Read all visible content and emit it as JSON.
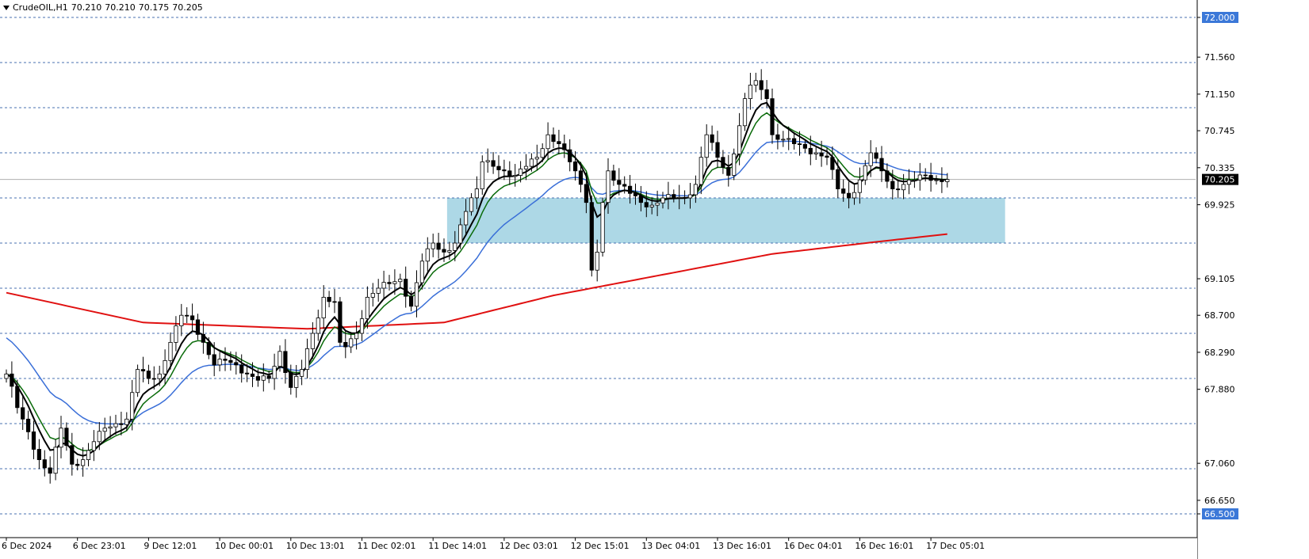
{
  "header": {
    "symbol": "CrudeOIL,H1",
    "open": "70.210",
    "high": "70.210",
    "low": "70.175",
    "close": "70.205"
  },
  "colors": {
    "background": "#ffffff",
    "grid_dashed": "#4a72b0",
    "level_badge": "#3b78d8",
    "current_badge": "#000000",
    "zone_fill": "#add8e6",
    "ma_black": "#000000",
    "ma_green": "#0a6b0a",
    "ma_blue": "#3a6fd8",
    "ma_red": "#e01010",
    "candle_border": "#000000",
    "candle_bull": "#ffffff",
    "candle_bear": "#000000"
  },
  "chart_data": {
    "type": "candlestick",
    "ylim": [
      66.5,
      72.2
    ],
    "y_tick_labels": [
      "72.000",
      "71.560",
      "71.150",
      "70.745",
      "70.335",
      "69.925",
      "69.105",
      "68.700",
      "68.290",
      "67.880",
      "67.060",
      "66.650",
      "66.500"
    ],
    "level_lines": [
      "72.000",
      "71.500",
      "71.000",
      "70.500",
      "70.000",
      "69.500",
      "69.000",
      "68.500",
      "68.000",
      "67.500",
      "67.000",
      "66.500"
    ],
    "current_price": "70.205",
    "x_tick_labels": [
      "6 Dec 2024",
      "6 Dec 23:01",
      "9 Dec 12:01",
      "10 Dec 00:01",
      "10 Dec 13:01",
      "11 Dec 02:01",
      "11 Dec 14:01",
      "12 Dec 03:01",
      "12 Dec 15:01",
      "13 Dec 04:01",
      "13 Dec 16:01",
      "16 Dec 04:01",
      "16 Dec 16:01",
      "17 Dec 05:01"
    ],
    "x_tick_bar_index": [
      0,
      13,
      26,
      39,
      52,
      65,
      78,
      91,
      104,
      117,
      130,
      143,
      156,
      169
    ],
    "zone": {
      "bar_start": 81,
      "bar_end": 183,
      "y_low": 69.5,
      "y_high": 70.0
    },
    "anchors": [
      [
        0,
        68.05
      ],
      [
        3,
        67.55
      ],
      [
        6,
        67.1
      ],
      [
        8,
        66.95
      ],
      [
        10,
        67.45
      ],
      [
        12,
        67.05
      ],
      [
        14,
        67.1
      ],
      [
        16,
        67.3
      ],
      [
        18,
        67.45
      ],
      [
        20,
        67.5
      ],
      [
        22,
        67.55
      ],
      [
        24,
        68.1
      ],
      [
        26,
        68.0
      ],
      [
        28,
        68.05
      ],
      [
        30,
        68.4
      ],
      [
        32,
        68.7
      ],
      [
        34,
        68.65
      ],
      [
        36,
        68.4
      ],
      [
        38,
        68.15
      ],
      [
        40,
        68.2
      ],
      [
        42,
        68.15
      ],
      [
        44,
        68.05
      ],
      [
        46,
        67.98
      ],
      [
        48,
        68.0
      ],
      [
        50,
        68.3
      ],
      [
        52,
        67.9
      ],
      [
        54,
        68.1
      ],
      [
        56,
        68.5
      ],
      [
        58,
        68.9
      ],
      [
        60,
        68.85
      ],
      [
        61,
        68.4
      ],
      [
        62,
        68.35
      ],
      [
        64,
        68.5
      ],
      [
        66,
        68.9
      ],
      [
        68,
        69.0
      ],
      [
        70,
        69.05
      ],
      [
        72,
        69.1
      ],
      [
        74,
        68.8
      ],
      [
        76,
        69.3
      ],
      [
        78,
        69.5
      ],
      [
        80,
        69.4
      ],
      [
        82,
        69.5
      ],
      [
        84,
        69.85
      ],
      [
        86,
        70.1
      ],
      [
        87,
        70.4
      ],
      [
        89,
        70.35
      ],
      [
        91,
        70.3
      ],
      [
        93,
        70.25
      ],
      [
        95,
        70.35
      ],
      [
        97,
        70.45
      ],
      [
        99,
        70.7
      ],
      [
        101,
        70.6
      ],
      [
        103,
        70.4
      ],
      [
        104,
        70.3
      ],
      [
        105,
        70.15
      ],
      [
        106,
        69.95
      ],
      [
        107,
        69.2
      ],
      [
        108,
        69.4
      ],
      [
        109,
        69.95
      ],
      [
        110,
        70.3
      ],
      [
        112,
        70.15
      ],
      [
        114,
        70.05
      ],
      [
        116,
        69.95
      ],
      [
        118,
        69.92
      ],
      [
        120,
        70.0
      ],
      [
        122,
        70.0
      ],
      [
        124,
        70.0
      ],
      [
        126,
        70.15
      ],
      [
        127,
        70.45
      ],
      [
        128,
        70.7
      ],
      [
        130,
        70.45
      ],
      [
        132,
        70.25
      ],
      [
        134,
        70.8
      ],
      [
        135,
        71.1
      ],
      [
        136,
        71.25
      ],
      [
        137,
        71.3
      ],
      [
        138,
        71.2
      ],
      [
        139,
        71.1
      ],
      [
        140,
        70.7
      ],
      [
        142,
        70.65
      ],
      [
        144,
        70.6
      ],
      [
        146,
        70.55
      ],
      [
        148,
        70.5
      ],
      [
        150,
        70.45
      ],
      [
        152,
        70.1
      ],
      [
        154,
        70.0
      ],
      [
        156,
        70.2
      ],
      [
        158,
        70.5
      ],
      [
        160,
        70.3
      ],
      [
        162,
        70.1
      ],
      [
        164,
        70.15
      ],
      [
        166,
        70.2
      ],
      [
        168,
        70.25
      ],
      [
        170,
        70.2
      ],
      [
        172,
        70.205
      ]
    ],
    "ma_red": [
      [
        0,
        68.95
      ],
      [
        25,
        68.62
      ],
      [
        55,
        68.55
      ],
      [
        80,
        68.62
      ],
      [
        100,
        68.92
      ],
      [
        120,
        69.15
      ],
      [
        140,
        69.38
      ],
      [
        160,
        69.52
      ],
      [
        172,
        69.6
      ]
    ]
  }
}
